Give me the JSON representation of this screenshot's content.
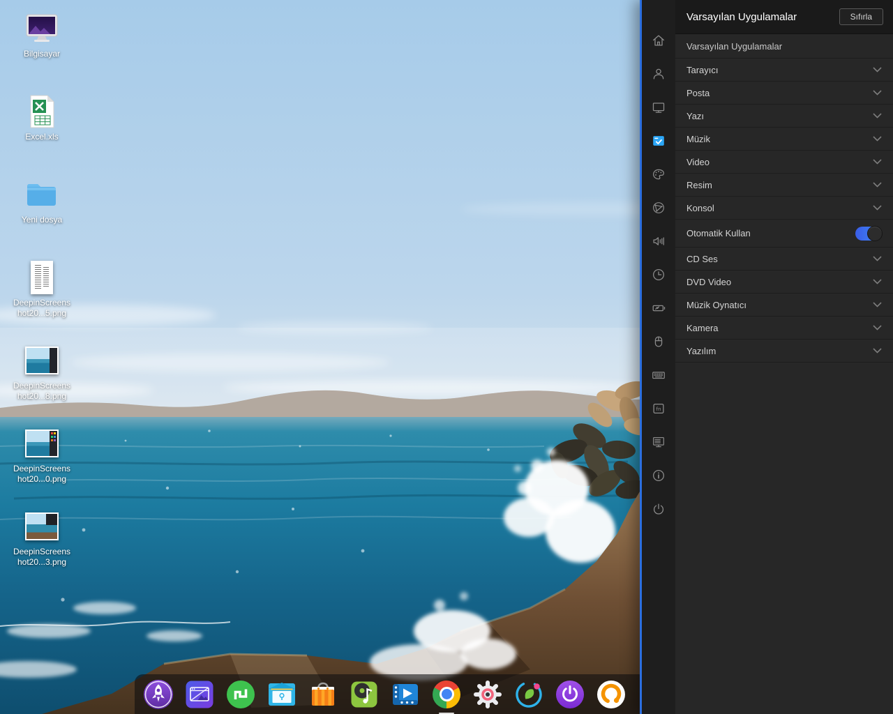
{
  "control_center": {
    "title": "Varsayılan Uygulamalar",
    "reset_button": "Sıfırla",
    "section_header": "Varsayılan Uygulamalar",
    "rows": [
      "Tarayıcı",
      "Posta",
      "Yazı",
      "Müzik",
      "Video",
      "Resim",
      "Konsol"
    ],
    "auto_row": {
      "label": "Otomatik Kullan",
      "state": "on"
    },
    "media_rows": [
      "CD Ses",
      "DVD Video",
      "Müzik Oynatıcı",
      "Kamera",
      "Yazılım"
    ]
  },
  "sidebar": {
    "active_item": "default-applications",
    "items": [
      "home",
      "accounts",
      "display",
      "default-applications",
      "personalization",
      "network",
      "sound",
      "datetime",
      "battery",
      "mouse",
      "keyboard",
      "fn-shortcuts",
      "boot-menu",
      "system-info",
      "power"
    ]
  },
  "desktop_icons": [
    {
      "icon": "computer",
      "line1": "Bilgisayar"
    },
    {
      "icon": "excel-file",
      "line1": "Excel.xls"
    },
    {
      "icon": "folder",
      "line1": "Yeni dosya"
    },
    {
      "icon": "image-file",
      "line1": "DeepinScreens",
      "line2": "hot20...5.png"
    },
    {
      "icon": "image-file",
      "line1": "DeepinScreens",
      "line2": "hot20...8.png"
    },
    {
      "icon": "image-file",
      "line1": "DeepinScreens",
      "line2": "hot20...0.png"
    },
    {
      "icon": "image-file",
      "line1": "DeepinScreens",
      "line2": "hot20...3.png"
    }
  ],
  "dock": {
    "items": [
      "launcher",
      "file-manager",
      "package-app",
      "mail-app",
      "app-store",
      "music-player",
      "movie-player",
      "chrome-browser",
      "control-center",
      "leaf-app",
      "power",
      "voice-recorder",
      "hidden-app"
    ],
    "running": [
      "chrome-browser"
    ]
  },
  "colors": {
    "sidebar_active": "#2ca7f8",
    "toggle_on": "#3f6ef0",
    "panel_edge": "#2b6fe0"
  }
}
